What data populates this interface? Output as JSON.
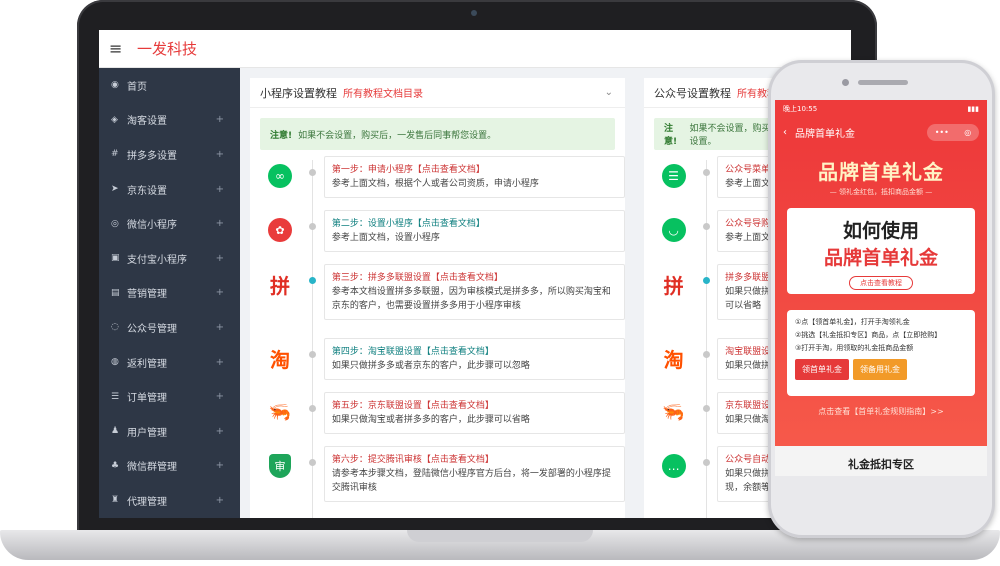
{
  "app": {
    "brand": "一发科技",
    "menu_icon": "hamburger-icon"
  },
  "sidebar": {
    "items": [
      {
        "label": "首页",
        "icon": "dashboard-icon",
        "expandable": false
      },
      {
        "label": "淘客设置",
        "icon": "share-icon",
        "expandable": true
      },
      {
        "label": "拼多多设置",
        "icon": "hash-icon",
        "expandable": true
      },
      {
        "label": "京东设置",
        "icon": "send-icon",
        "expandable": true
      },
      {
        "label": "微信小程序",
        "icon": "compass-icon",
        "expandable": true
      },
      {
        "label": "支付宝小程序",
        "icon": "wallet-icon",
        "expandable": true
      },
      {
        "label": "营销管理",
        "icon": "chart-icon",
        "expandable": true
      },
      {
        "label": "公众号管理",
        "icon": "chat-icon",
        "expandable": true
      },
      {
        "label": "返利管理",
        "icon": "coin-icon",
        "expandable": true
      },
      {
        "label": "订单管理",
        "icon": "list-icon",
        "expandable": true
      },
      {
        "label": "用户管理",
        "icon": "user-icon",
        "expandable": true
      },
      {
        "label": "微信群管理",
        "icon": "group-icon",
        "expandable": true
      },
      {
        "label": "代理管理",
        "icon": "agent-icon",
        "expandable": true
      }
    ]
  },
  "panel_a": {
    "title": "小程序设置教程",
    "link": "所有教程文档目录",
    "notice_label": "注意!",
    "notice_text": "如果不会设置，购买后，一发售后同事帮您设置。",
    "steps": [
      {
        "title": "第一步：申请小程序【点击查看文档】",
        "desc": "参考上面文档，根据个人或者公司资质，申请小程序",
        "icon": "mini-program-icon",
        "title_color": "red"
      },
      {
        "title": "第二步：设置小程序【点击查看文档】",
        "desc": "参考上面文档，设置小程序",
        "icon": "xiaoguo-red-icon",
        "title_color": "teal"
      },
      {
        "title": "第三步：拼多多联盟设置【点击查看文档】",
        "desc": "参考本文档设置拼多多联盟，因为审核模式是拼多多，所以购买淘宝和京东的客户，也需要设置拼多多用于小程序审核",
        "icon": "pinduoduo-icon",
        "title_color": "red"
      },
      {
        "title": "第四步：淘宝联盟设置【点击查看文档】",
        "desc": "如果只做拼多多或者京东的客户，此步骤可以忽略",
        "icon": "taobao-icon",
        "title_color": "teal"
      },
      {
        "title": "第五步：京东联盟设置【点击查看文档】",
        "desc": "如果只做淘宝或者拼多多的客户，此步骤可以省略",
        "icon": "jd-icon",
        "title_color": "red"
      },
      {
        "title": "第六步：提交腾讯审核【点击查看文档】",
        "desc": "请参考本步骤文档，登陆微信小程序官方后台，将一发部署的小程序提交腾讯审核",
        "icon": "shield-icon",
        "title_color": "red"
      }
    ]
  },
  "panel_b": {
    "title": "公众号设置教程",
    "link": "所有教程",
    "notice_label": "注意!",
    "notice_text": "如果不会设置，购买后，一发售后同事帮您设置。",
    "steps": [
      {
        "title": "公众号菜单",
        "desc": "参考上面文",
        "icon": "menu-list-icon"
      },
      {
        "title": "公众号导购",
        "desc": "参考上面文",
        "icon": "smile-icon"
      },
      {
        "title": "拼多多联盟",
        "desc": "如果只做拼多",
        "extra": "可以省略",
        "icon": "pinduoduo-icon"
      },
      {
        "title": "淘宝联盟设",
        "desc": "如果只做拼多",
        "icon": "taobao-icon"
      },
      {
        "title": "京东联盟设",
        "desc": "如果只做淘宝",
        "icon": "jd-icon"
      },
      {
        "title": "公众号自动",
        "desc": "如果只做拼多",
        "extra": "现，余额等",
        "icon": "wechat-chat-icon"
      }
    ]
  },
  "phone": {
    "status_time": "晚上10:55",
    "nav_title": "品牌首单礼金",
    "hero_title": "品牌首单礼金",
    "hero_sub": "— 领礼金红包，抵扣商品金额 —",
    "card_line1": "如何使用",
    "card_line2": "品牌首单礼金",
    "card_button": "点击查看教程",
    "steps": [
      "①点【领首单礼金】，打开手淘领礼金",
      "②挑选【礼金抵扣专区】商品，点【立即抢购】",
      "③打开手淘，用领取的礼金抵商品金额"
    ],
    "btn_primary": "领首单礼金",
    "btn_secondary": "领备用礼金",
    "rules_link": "点击查看【首单礼金规则指南】>>",
    "zone_title": "礼金抵扣专区"
  }
}
